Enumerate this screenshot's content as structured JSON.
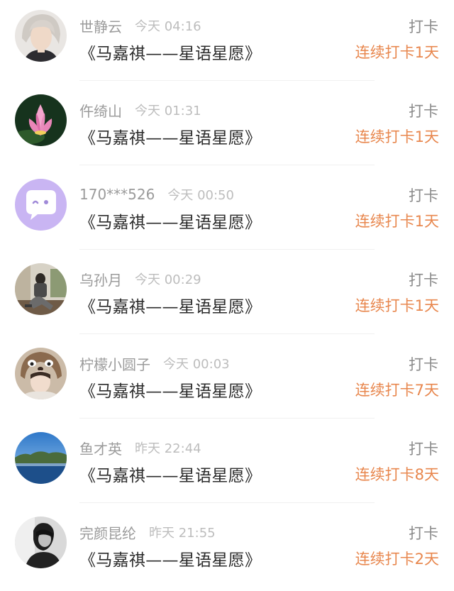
{
  "checkins": [
    {
      "username": "世静云",
      "time": "今天 04:16",
      "book": "《马嘉祺——星语星愿》",
      "tag": "打卡",
      "streak": "连续打卡1天",
      "avatar_icon": "man-portrait-avatar"
    },
    {
      "username": "仵绮山",
      "time": "今天 01:31",
      "book": "《马嘉祺——星语星愿》",
      "tag": "打卡",
      "streak": "连续打卡1天",
      "avatar_icon": "lotus-flower-avatar"
    },
    {
      "username": "170***526",
      "time": "今天 00:50",
      "book": "《马嘉祺——星语星愿》",
      "tag": "打卡",
      "streak": "连续打卡1天",
      "avatar_icon": "chat-bubble-avatar"
    },
    {
      "username": "乌孙月",
      "time": "今天 00:29",
      "book": "《马嘉祺——星语星愿》",
      "tag": "打卡",
      "streak": "连续打卡1天",
      "avatar_icon": "sitting-man-avatar"
    },
    {
      "username": "柠檬小圆子",
      "time": "今天 00:03",
      "book": "《马嘉祺——星语星愿》",
      "tag": "打卡",
      "streak": "连续打卡7天",
      "avatar_icon": "plush-hat-girl-avatar"
    },
    {
      "username": "鱼才英",
      "time": "昨天 22:44",
      "book": "《马嘉祺——星语星愿》",
      "tag": "打卡",
      "streak": "连续打卡8天",
      "avatar_icon": "sea-landscape-avatar"
    },
    {
      "username": "完颜昆纶",
      "time": "昨天 21:55",
      "book": "《马嘉祺——星语星愿》",
      "tag": "打卡",
      "streak": "连续打卡2天",
      "avatar_icon": "dark-portrait-avatar"
    }
  ],
  "colors": {
    "username": "#9b9b9b",
    "time": "#bdbdbd",
    "book": "#2b2b2b",
    "tag": "#8a8a8a",
    "streak": "#e8874e",
    "divider": "#f0f0f0"
  }
}
